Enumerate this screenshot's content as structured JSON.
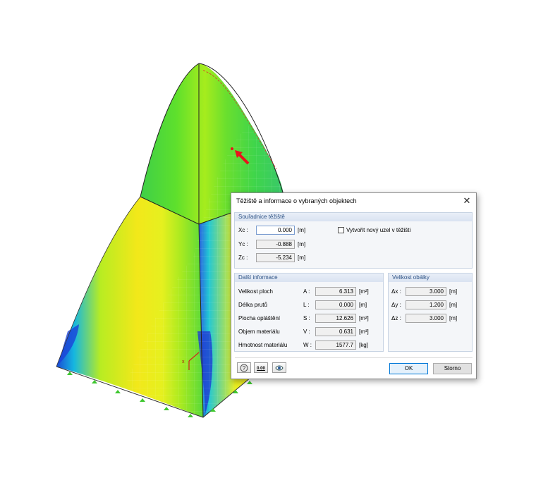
{
  "dialog": {
    "title": "Těžiště a informace o vybraných objektech",
    "close_glyph": "✕",
    "centroid": {
      "header": "Souřadnice těžiště",
      "rows": [
        {
          "sym": "Xc :",
          "value": "0.000",
          "unit": "[m]"
        },
        {
          "sym": "Yc :",
          "value": "-0.888",
          "unit": "[m]"
        },
        {
          "sym": "Zc :",
          "value": "-5.234",
          "unit": "[m]"
        }
      ],
      "create_node_label": "Vytvořit nový uzel v těžišti",
      "create_node_checked": false
    },
    "info": {
      "header": "Další informace",
      "rows": [
        {
          "label": "Velikost ploch",
          "sym": "A :",
          "value": "6.313",
          "unit": "[m²]"
        },
        {
          "label": "Délka prutů",
          "sym": "L :",
          "value": "0.000",
          "unit": "[m]"
        },
        {
          "label": "Plocha opláštění",
          "sym": "S :",
          "value": "12.626",
          "unit": "[m²]"
        },
        {
          "label": "Objem materiálu",
          "sym": "V :",
          "value": "0.631",
          "unit": "[m³]"
        },
        {
          "label": "Hmotnost materiálu",
          "sym": "W :",
          "value": "1577.7",
          "unit": "[kg]"
        }
      ]
    },
    "envelope": {
      "header": "Velikost obálky",
      "rows": [
        {
          "sym": "Δx :",
          "value": "3.000",
          "unit": "[m]"
        },
        {
          "sym": "Δy :",
          "value": "1.200",
          "unit": "[m]"
        },
        {
          "sym": "Δz :",
          "value": "3.000",
          "unit": "[m]"
        }
      ]
    },
    "footer": {
      "icons": [
        "help-icon",
        "calculator-icon",
        "eye-icon"
      ],
      "decimals_icon_text": "0.00",
      "ok_label": "OK",
      "cancel_label": "Storno"
    }
  },
  "colors": {
    "accent": "#0078d7",
    "group_header_text": "#2d5285",
    "arrow": "#e8131b"
  }
}
